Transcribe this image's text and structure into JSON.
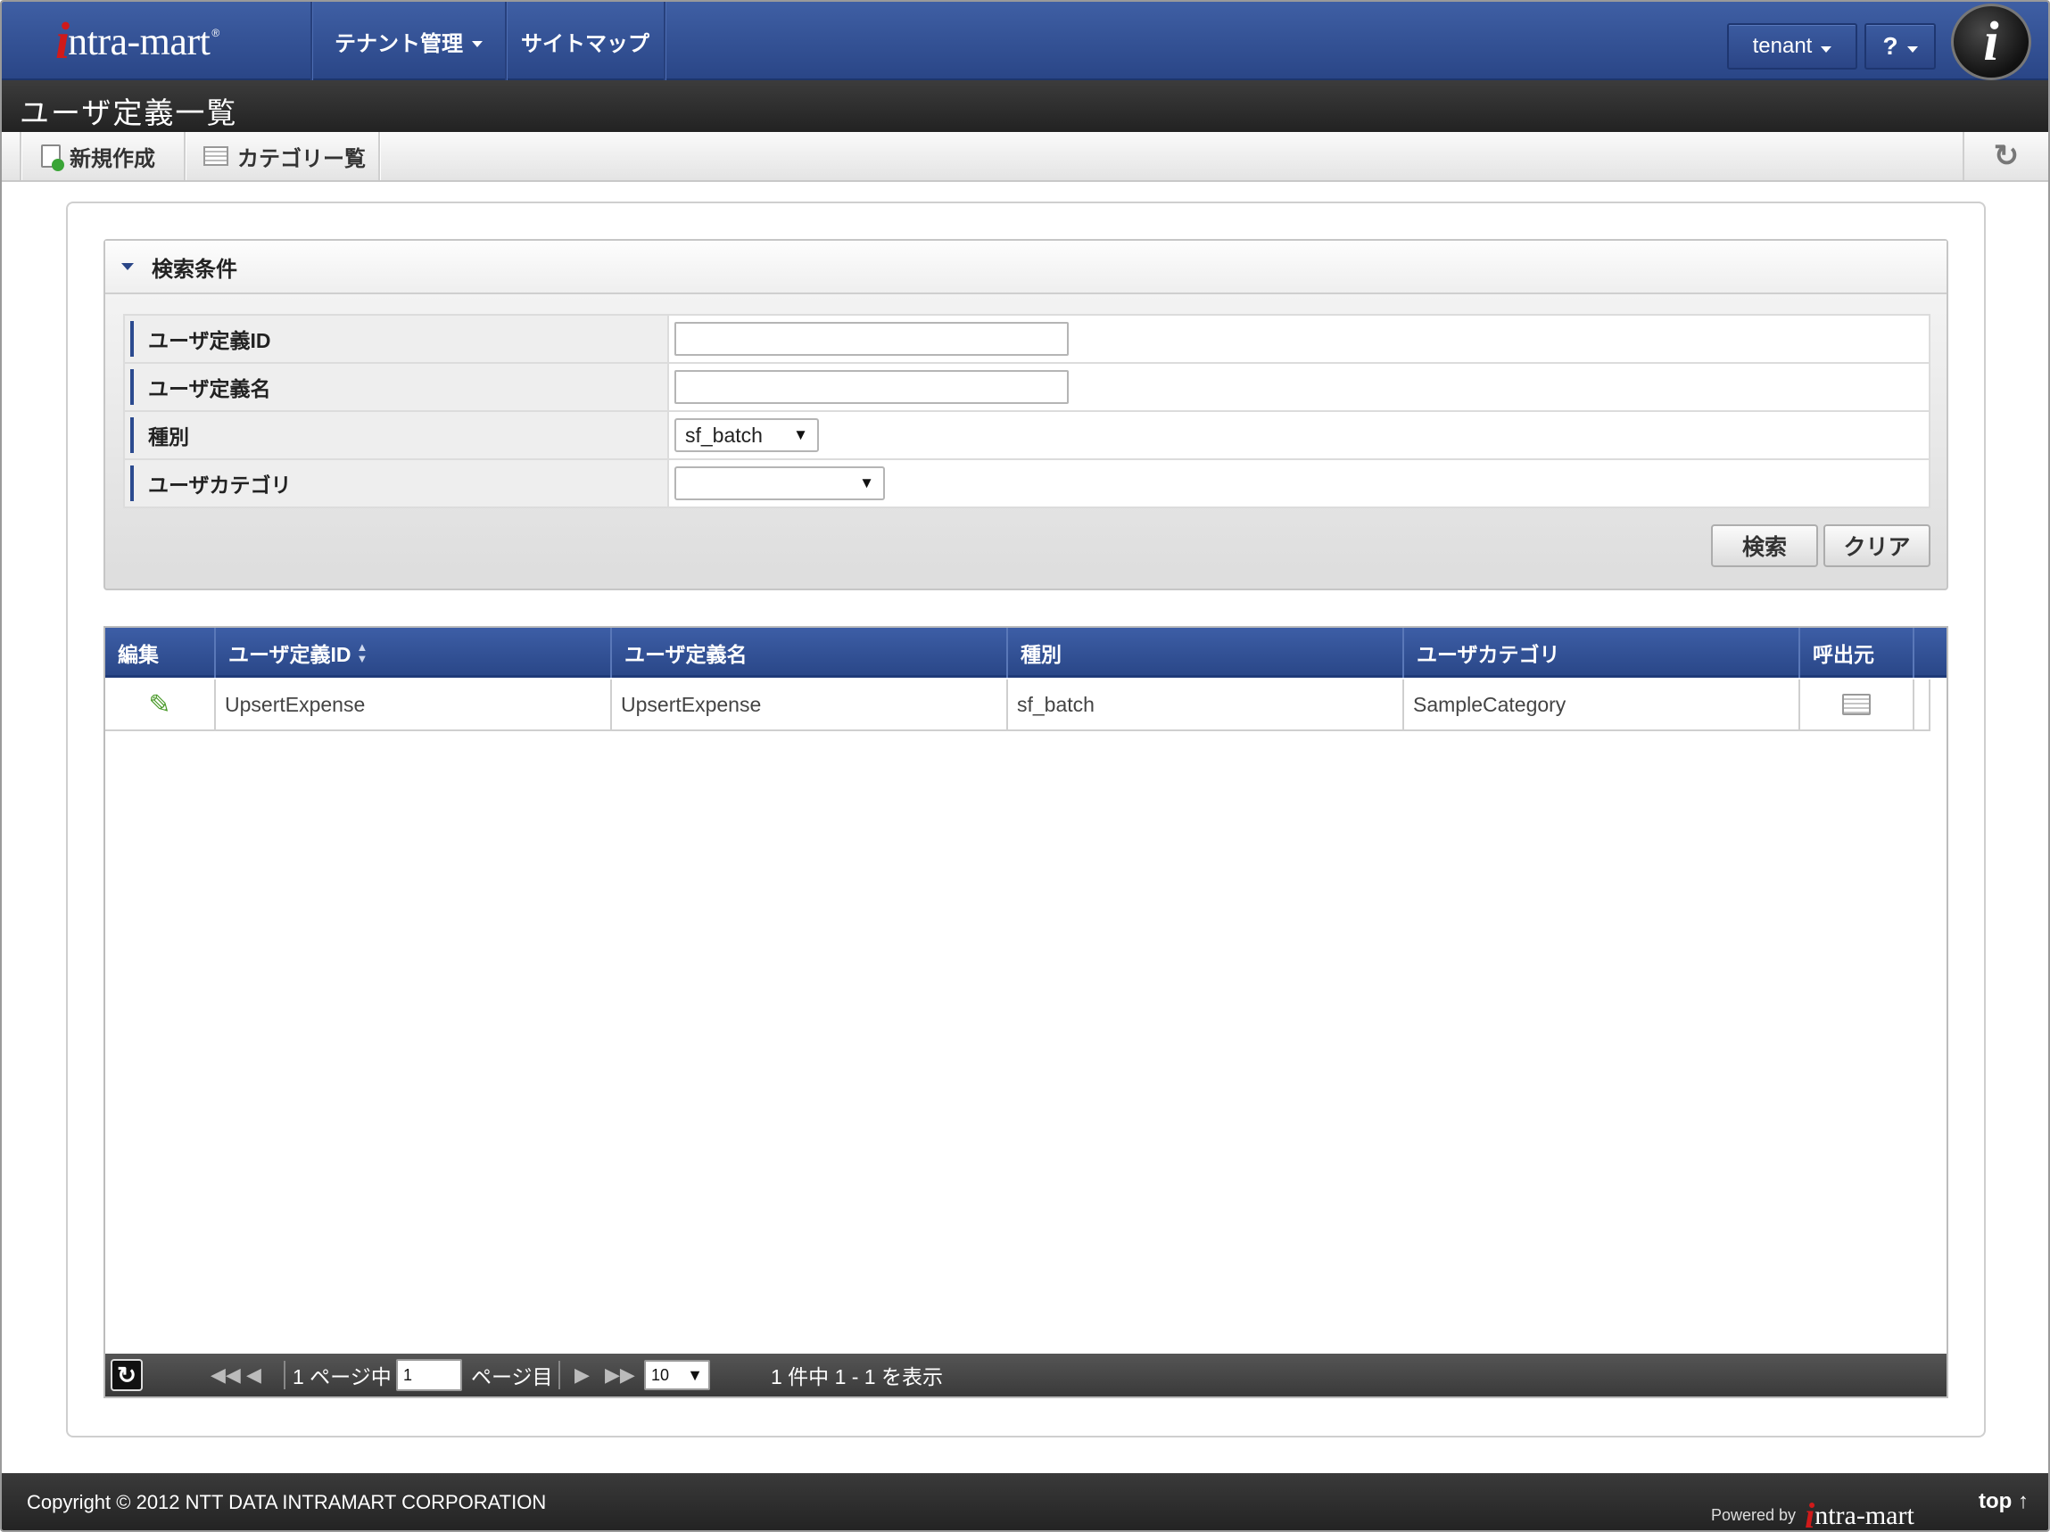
{
  "header": {
    "logo_i": "i",
    "logo_rest": "ntra-mart",
    "logo_reg": "®",
    "nav": [
      {
        "label": "テナント管理"
      },
      {
        "label": "サイトマップ"
      }
    ],
    "tenant_label": "tenant",
    "help_label": "?",
    "user_icon_letter": "i"
  },
  "page": {
    "title": "ユーザ定義一覧"
  },
  "toolbar": {
    "new_label": "新規作成",
    "category_list_label": "カテゴリー覧",
    "refresh_glyph": "↻"
  },
  "search": {
    "section_title": "検索条件",
    "fields": [
      {
        "label": "ユーザ定義ID",
        "value": ""
      },
      {
        "label": "ユーザ定義名",
        "value": ""
      },
      {
        "label": "種別",
        "value": "sf_batch"
      },
      {
        "label": "ユーザカテゴリ",
        "value": ""
      }
    ],
    "search_button": "検索",
    "clear_button": "クリア"
  },
  "grid": {
    "columns": [
      "編集",
      "ユーザ定義ID",
      "ユーザ定義名",
      "種別",
      "ユーザカテゴリ",
      "呼出元"
    ],
    "sort_up": "▲",
    "sort_down": "▼",
    "rows": [
      {
        "id": "UpsertExpense",
        "name": "UpsertExpense",
        "type": "sf_batch",
        "category": "SampleCategory"
      }
    ],
    "pager": {
      "first": "◀◀",
      "prev": "◀",
      "page_prefix": "1 ページ中",
      "page_input": "1",
      "page_suffix": "ページ目",
      "next": "▶",
      "last": "▶▶",
      "per_page": "10",
      "summary": "1 件中 1 - 1 を表示",
      "refresh_glyph": "↻"
    }
  },
  "footer": {
    "copyright": "Copyright © 2012 NTT DATA INTRAMART CORPORATION",
    "powered_by": "Powered by",
    "logo_i": "i",
    "logo_rest": "ntra-mart",
    "top_link": "top ↑"
  },
  "colors": {
    "header_blue": "#2a4687",
    "title_bar": "#2a2a2a",
    "logo_red": "#d01a1a"
  }
}
